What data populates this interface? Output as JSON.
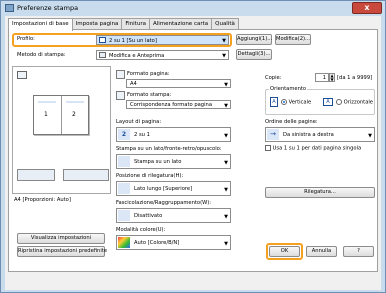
{
  "window": {
    "title": "Preferenze stampa",
    "close_label": "x"
  },
  "tabs": [
    "Impostazioni di base",
    "Imposta pagina",
    "Finitura",
    "Alimentazione carta",
    "Qualità"
  ],
  "profile": {
    "label": "Profilo:",
    "value": "2 su 1 [Su un lato]",
    "add_label": "Aggiungi(1)...",
    "edit_label": "Modifica(2)..."
  },
  "output": {
    "label": "Metodo di stampa:",
    "value": "Modifica e Anteprima",
    "details_label": "Dettagli(3)..."
  },
  "preview": {
    "page1": "1",
    "page2": "2",
    "caption": "A4 [Proporzioni: Auto]",
    "view_button": "Visualizza impostazioni",
    "restore_button": "Ripristina impostazioni predefinite"
  },
  "page_size": {
    "label": "Formato pagina:",
    "value": "A4"
  },
  "output_size": {
    "label": "Formato stampa:",
    "value": "Corrispondenza formato pagina"
  },
  "copies": {
    "label": "Copie:",
    "value": "1",
    "range": "[da 1 a 9999]"
  },
  "orientation": {
    "label": "Orientamento",
    "portrait": "Verticale",
    "landscape": "Orizzontale"
  },
  "layout": {
    "label": "Layout di pagina:",
    "value": "2 su 1"
  },
  "page_order": {
    "label": "Ordine delle pagine:",
    "value": "Da sinistra a destra",
    "single_label": "Usa 1 su 1 per dati pagina singola"
  },
  "duplex": {
    "label": "Stampa su un lato/fronte-retro/opuscolo:",
    "value": "Stampa su un lato"
  },
  "binding": {
    "label": "Posizione di rilegatura(H):",
    "value": "Lato lungo [Superiore]",
    "gutter_button": "Rilegatura..."
  },
  "finishing": {
    "label": "Fascicolazione/Raggruppamento(W):",
    "value": "Disattivato"
  },
  "color": {
    "label": "Modalità colore(U):",
    "value": "Auto [Colore/B/N]"
  },
  "footer": {
    "ok": "OK",
    "cancel": "Annulla",
    "help": "?"
  }
}
